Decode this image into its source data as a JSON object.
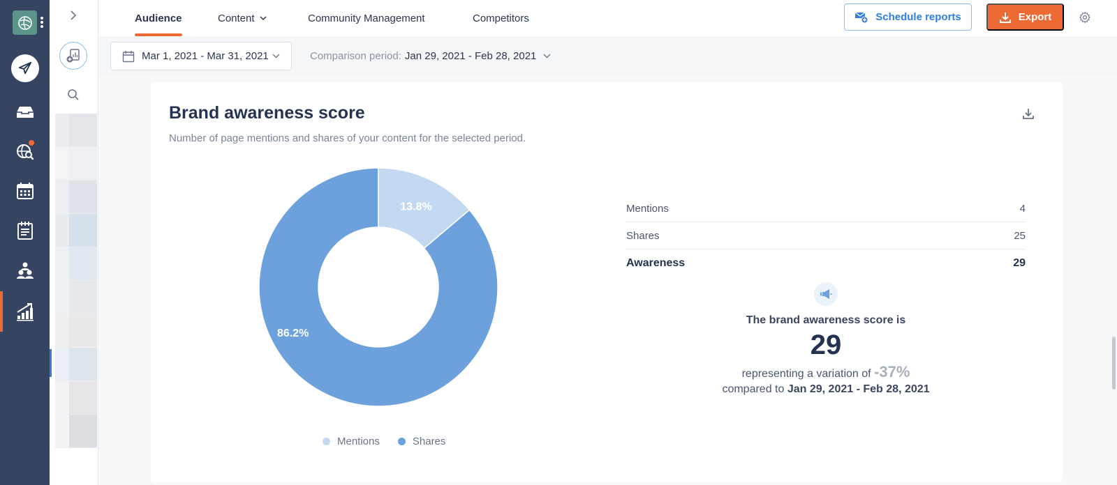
{
  "nav": {
    "items": [
      {
        "id": "publish",
        "icon": "paper-plane-icon"
      },
      {
        "id": "inbox",
        "icon": "inbox-tray-icon"
      },
      {
        "id": "listening",
        "icon": "globe-search-icon",
        "has_notification": true
      },
      {
        "id": "calendar",
        "icon": "calendar-icon"
      },
      {
        "id": "notes",
        "icon": "notepad-icon"
      },
      {
        "id": "community",
        "icon": "people-group-icon"
      },
      {
        "id": "analytics",
        "icon": "analytics-chart-icon",
        "active": true
      }
    ]
  },
  "header": {
    "tabs": [
      {
        "label": "Audience",
        "active": true
      },
      {
        "label": "Content",
        "has_dropdown": true
      },
      {
        "label": "Community Management"
      },
      {
        "label": "Competitors"
      }
    ],
    "schedule_label": "Schedule reports",
    "export_label": "Export"
  },
  "filters": {
    "date_range": "Mar 1, 2021 - Mar 31, 2021",
    "comparison_label": "Comparison period:",
    "comparison_range": "Jan 29, 2021 - Feb 28, 2021"
  },
  "card": {
    "title": "Brand awareness score",
    "subtitle": "Number of page mentions and shares of your content for the selected period.",
    "stats": [
      {
        "label": "Mentions",
        "value": "4"
      },
      {
        "label": "Shares",
        "value": "25"
      },
      {
        "label": "Awareness",
        "value": "29"
      }
    ],
    "summary": {
      "line1": "The brand awareness score is",
      "score": "29",
      "variation_prefix": "representing a variation of",
      "variation": "-37%",
      "compared_prefix": "compared to",
      "compared_range": "Jan 29, 2021 - Feb 28, 2021"
    }
  },
  "colors": {
    "accent": "#ee6a35",
    "primary_blue": "#2f7ee6",
    "mentions": "#c3d9f2",
    "shares": "#6ca1de"
  },
  "chart_data": {
    "type": "pie",
    "title": "Brand awareness score",
    "donut": true,
    "categories": [
      "Mentions",
      "Shares"
    ],
    "values": [
      4,
      25
    ],
    "percent_labels": [
      "13.8%",
      "86.2%"
    ],
    "colors": [
      "#c3d9f2",
      "#6ca1de"
    ],
    "legend": [
      "Mentions",
      "Shares"
    ],
    "legend_position": "bottom"
  }
}
